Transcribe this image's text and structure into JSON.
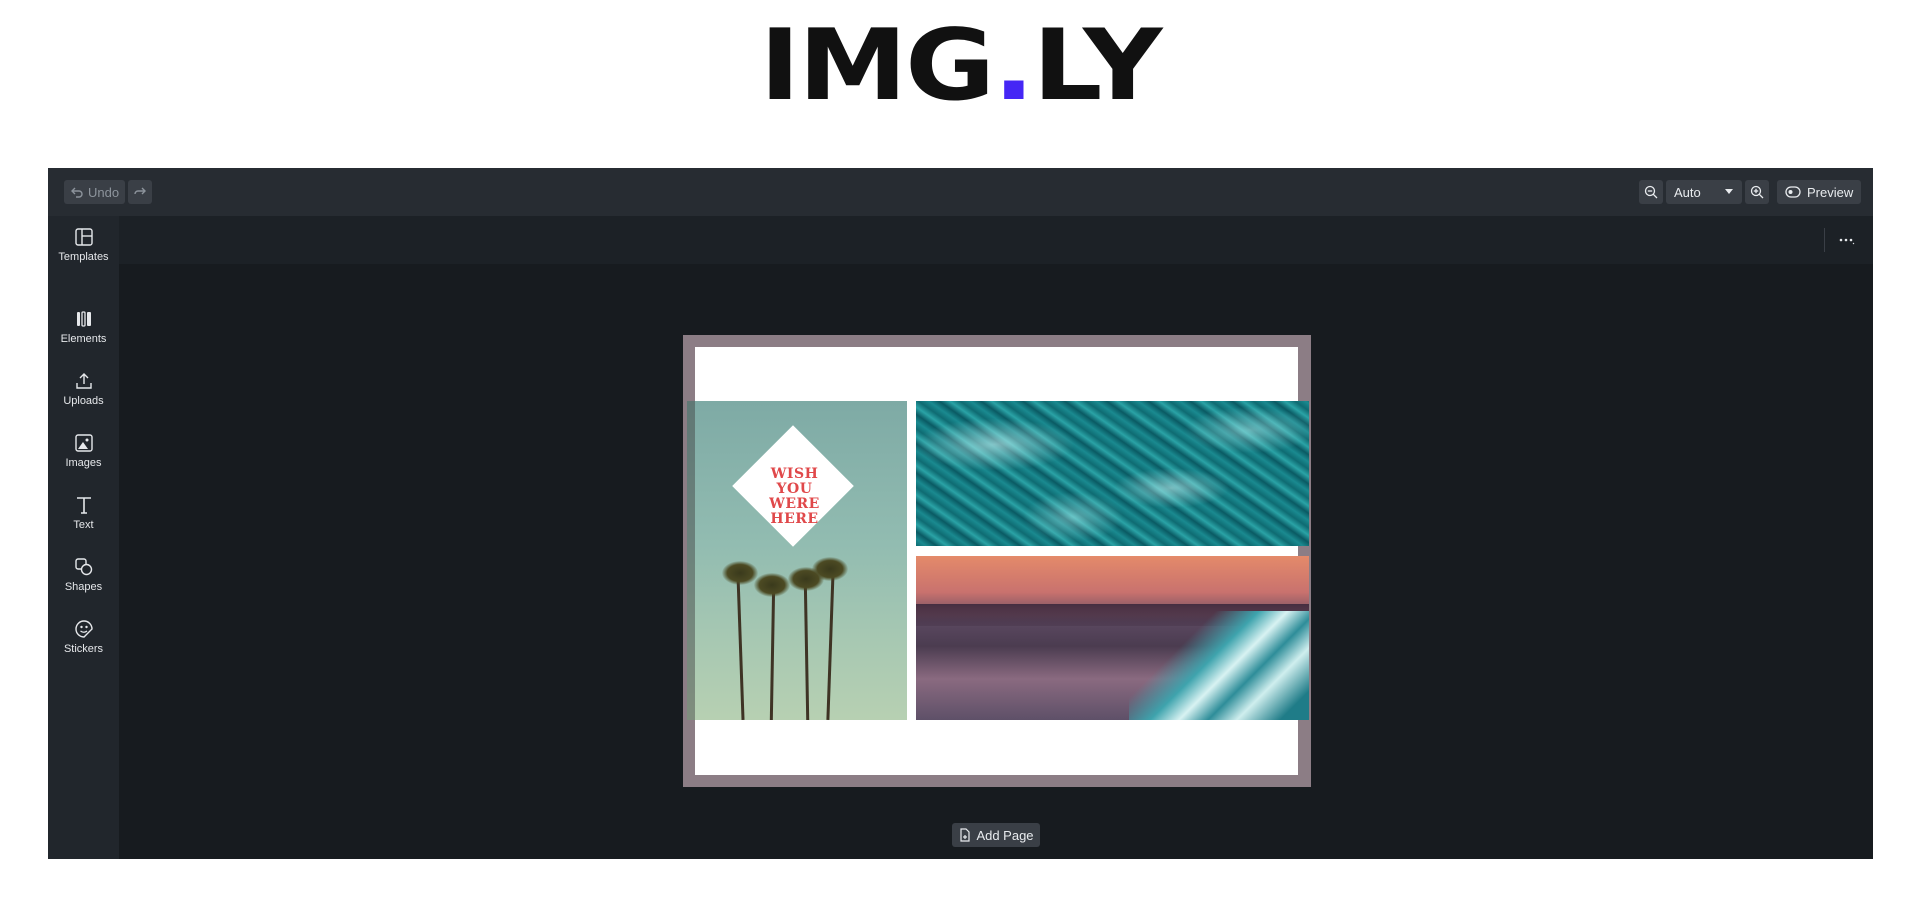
{
  "brand": {
    "name_left": "IMG",
    "dot": ".",
    "name_right": "LY",
    "accent_color": "#4526f5"
  },
  "toolbar": {
    "undo_label": "Undo",
    "redo_icon": "redo-icon",
    "zoom_out_icon": "zoom-out-icon",
    "zoom_value": "Auto",
    "zoom_in_icon": "zoom-in-icon",
    "preview_label": "Preview"
  },
  "sidebar": {
    "items": [
      {
        "label": "Templates",
        "icon": "templates-icon"
      },
      {
        "label": "Elements",
        "icon": "elements-icon"
      },
      {
        "label": "Uploads",
        "icon": "upload-icon"
      },
      {
        "label": "Images",
        "icon": "image-icon"
      },
      {
        "label": "Text",
        "icon": "text-icon"
      },
      {
        "label": "Shapes",
        "icon": "shapes-icon"
      },
      {
        "label": "Stickers",
        "icon": "sticker-icon"
      }
    ]
  },
  "subbar": {
    "more_icon": "more-options-icon"
  },
  "canvas": {
    "postcard_lines": [
      "WISH",
      "YOU",
      "WERE",
      "HERE"
    ]
  },
  "footer": {
    "add_page_label": "Add Page"
  }
}
